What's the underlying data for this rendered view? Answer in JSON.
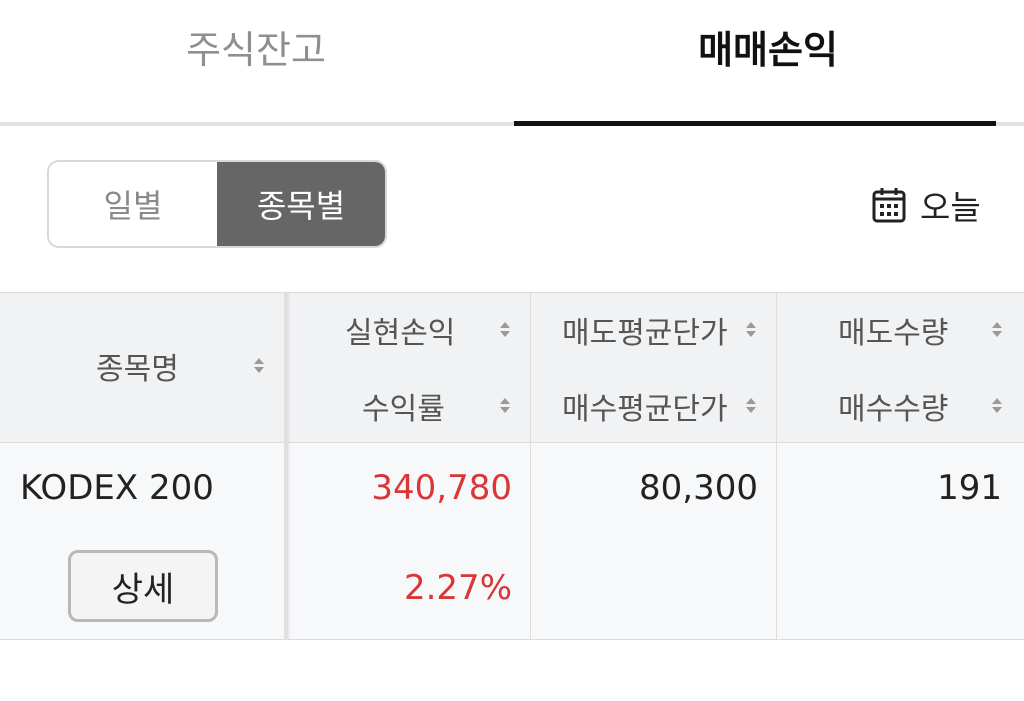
{
  "tabs": [
    {
      "label": "주식잔고",
      "active": false
    },
    {
      "label": "매매손익",
      "active": true
    }
  ],
  "segment": [
    {
      "label": "일별",
      "selected": false
    },
    {
      "label": "종목별",
      "selected": true
    }
  ],
  "date_selector": {
    "icon": "calendar-icon",
    "label": "오늘"
  },
  "table": {
    "headers": {
      "name": "종목명",
      "realized_pnl": "실현손익",
      "return_rate": "수익률",
      "sell_avg_price": "매도평균단가",
      "buy_avg_price": "매수평균단가",
      "sell_qty": "매도수량",
      "buy_qty": "매수수량"
    },
    "rows": [
      {
        "name": "KODEX 200",
        "detail_label": "상세",
        "realized_pnl": "340,780",
        "return_rate": "2.27%",
        "sell_avg_price": "80,300",
        "buy_avg_price": "",
        "sell_qty": "191",
        "buy_qty": ""
      }
    ]
  },
  "colors": {
    "profit": "#d93636",
    "segment_active": "#666666",
    "header_bg": "#f1f2f4",
    "row_bg": "#f7f8fa"
  }
}
